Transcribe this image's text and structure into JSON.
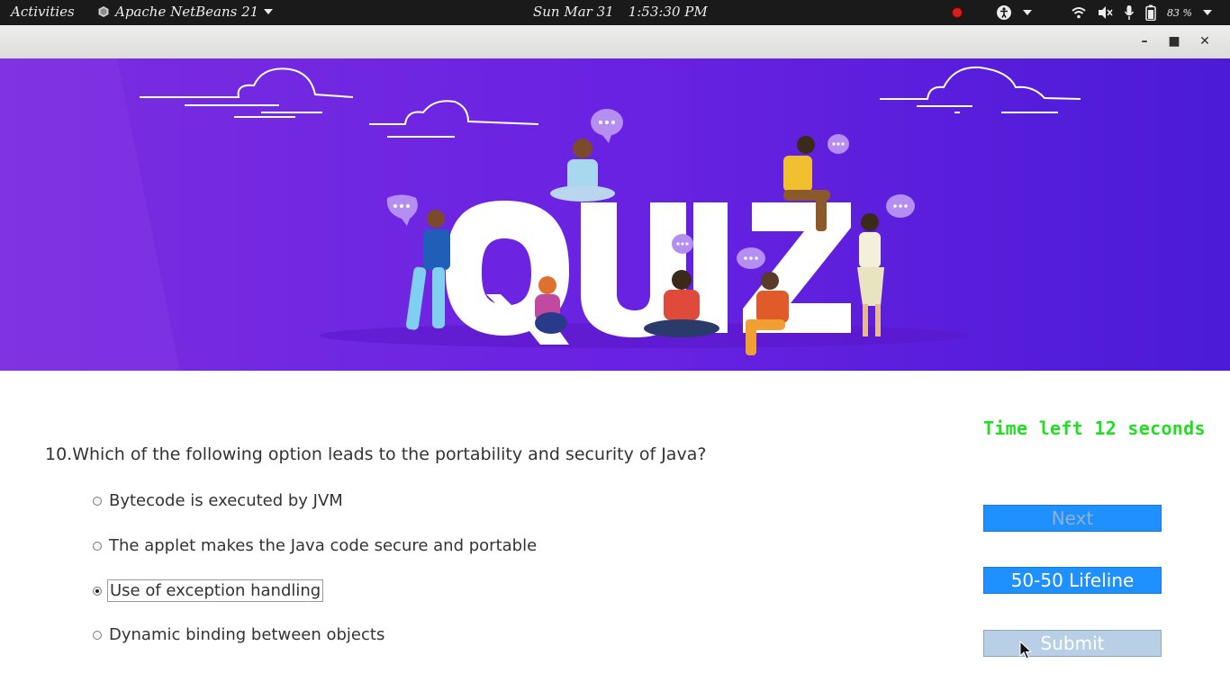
{
  "topbar": {
    "activities": "Activities",
    "app_name": "Apache NetBeans 21",
    "date": "Sun Mar 31",
    "time": "1:53:30 PM",
    "battery": "83 %"
  },
  "banner": {
    "word": "QUIZ"
  },
  "quiz": {
    "timer_text": "Time left 12 seconds",
    "question": "10.Which of the following option leads to the portability and security of Java?",
    "options": [
      {
        "label": "Bytecode is executed by JVM",
        "selected": false
      },
      {
        "label": "The applet makes the Java code secure and portable",
        "selected": false
      },
      {
        "label": "Use of exception handling",
        "selected": true
      },
      {
        "label": "Dynamic binding between objects",
        "selected": false
      }
    ],
    "next_label": "Next",
    "lifeline_label": "50-50 Lifeline",
    "submit_label": "Submit"
  },
  "colors": {
    "banner_start": "#7a2ee0",
    "banner_end": "#4b1bd6",
    "timer": "#22dd22",
    "button_blue": "#1e90ff",
    "submit_disabled": "#b8cfe6"
  }
}
